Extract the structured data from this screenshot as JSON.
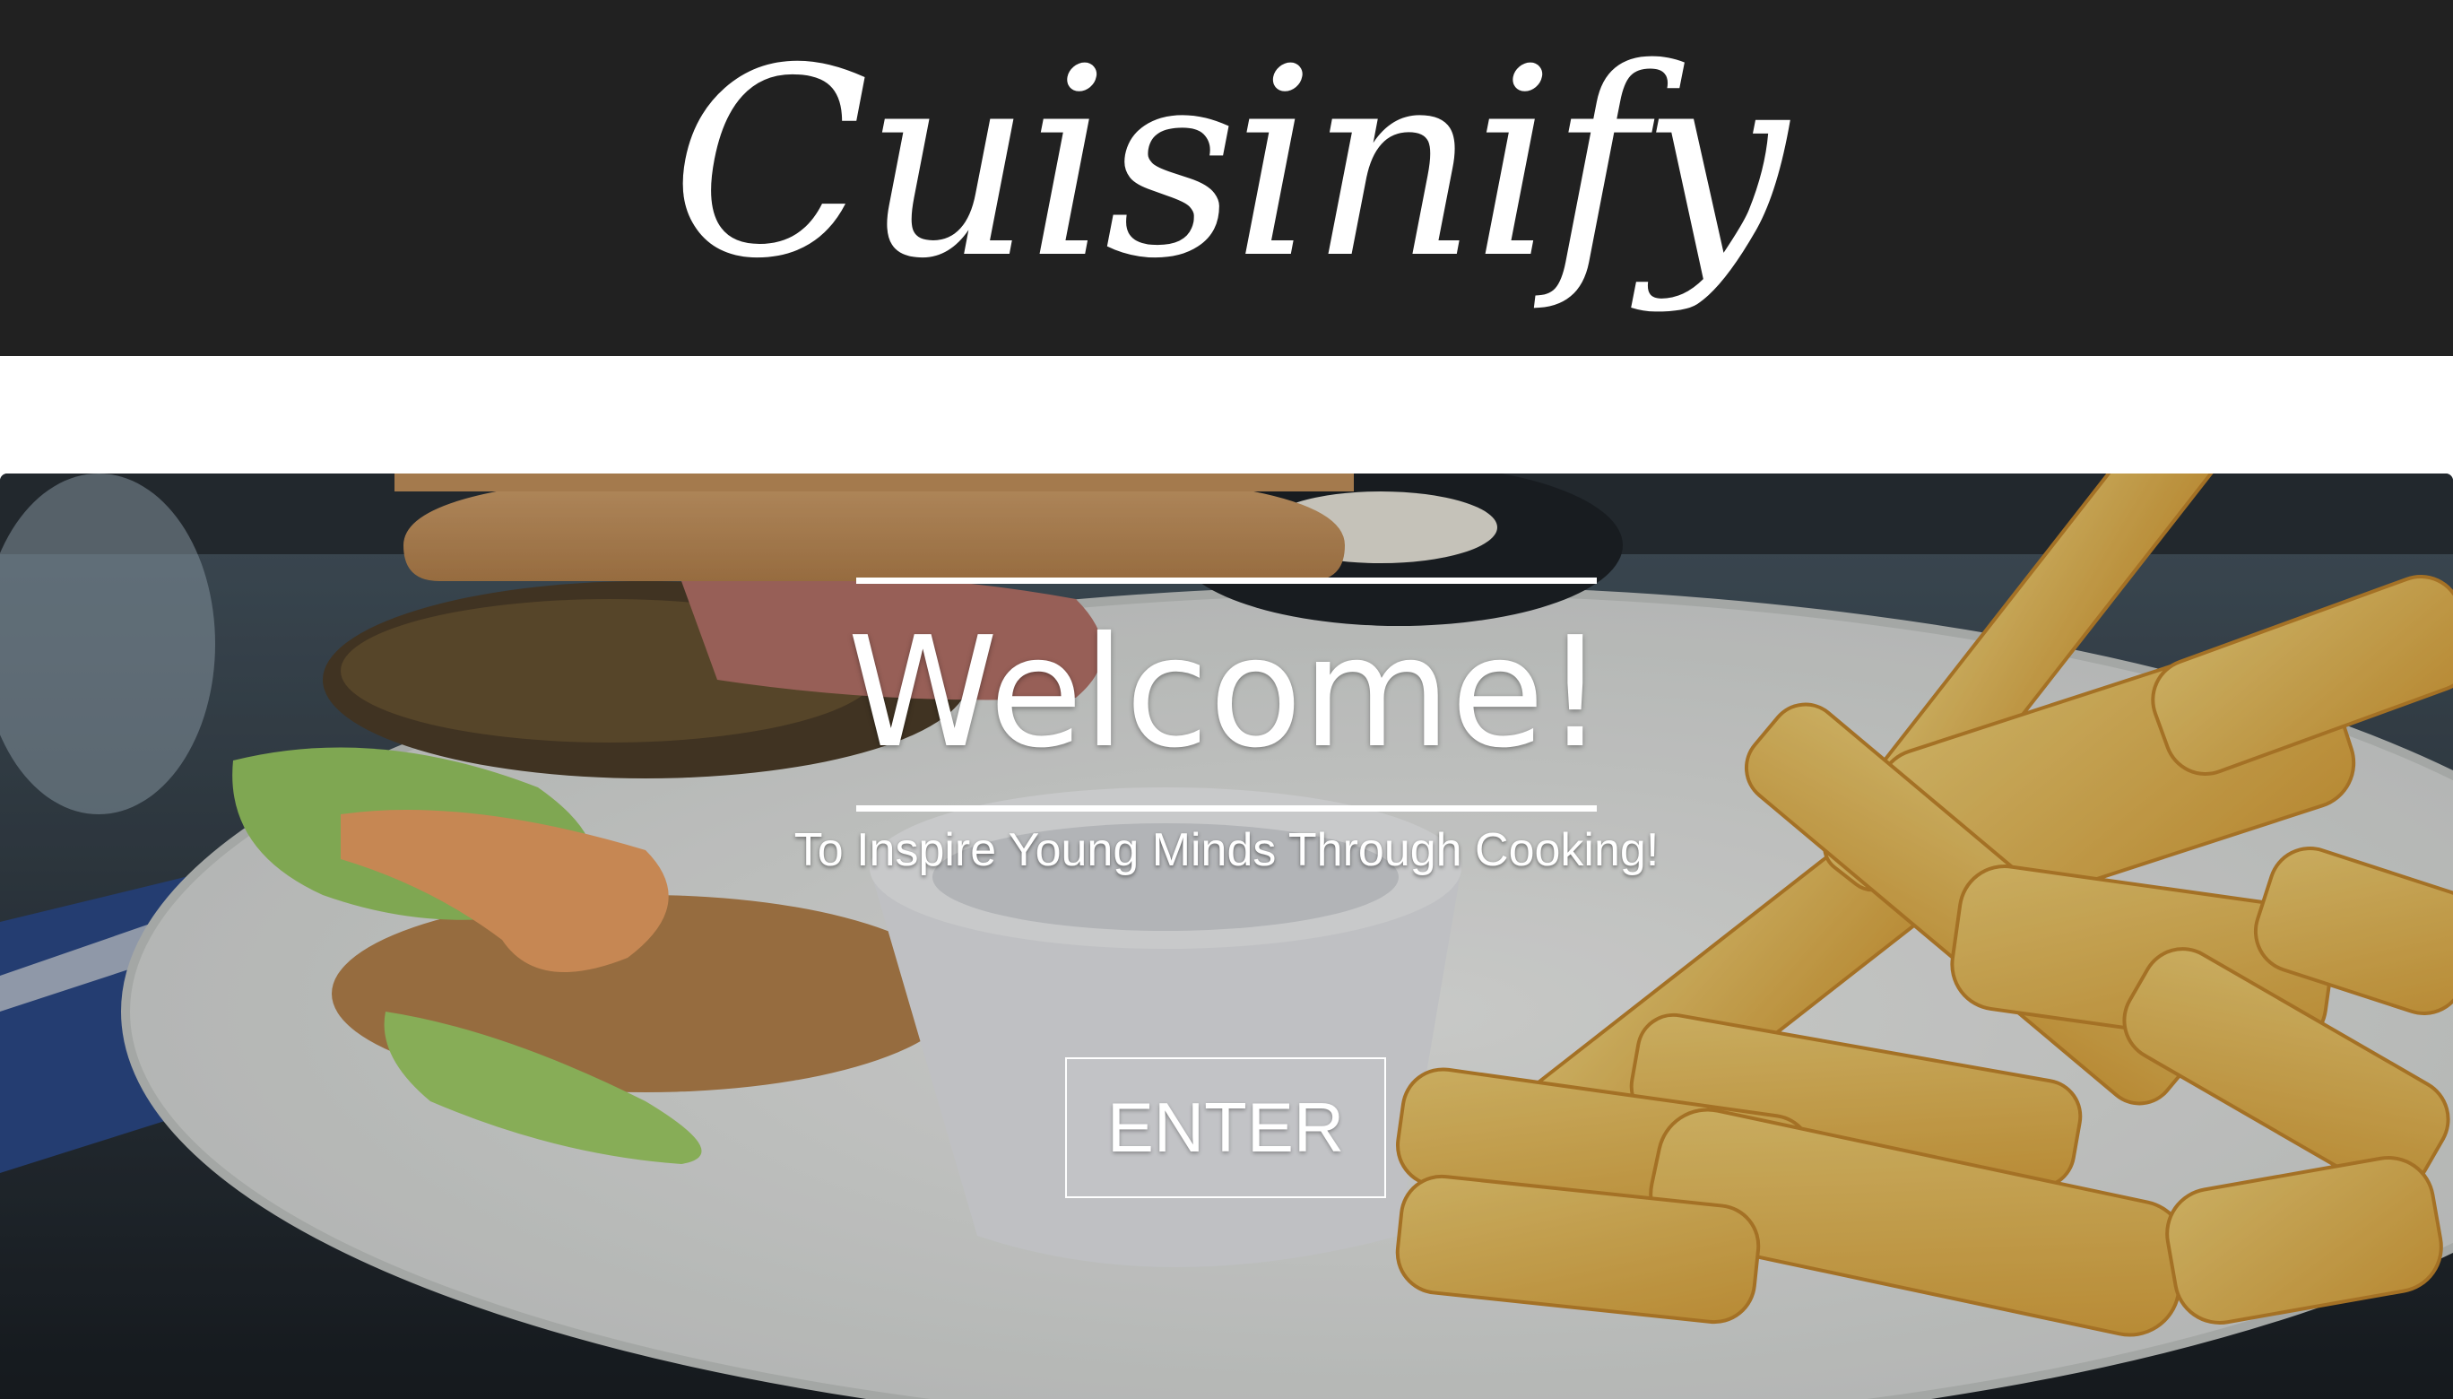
{
  "header": {
    "brand": "Cuisinify"
  },
  "hero": {
    "title": "Welcome!",
    "tagline": "To Inspire Young Minds Through Cooking!",
    "enter_label": "ENTER",
    "image_subject": "burger-and-fries-photo"
  },
  "colors": {
    "header_bg": "#212121",
    "text": "#ffffff",
    "page_bg": "#ffffff"
  }
}
